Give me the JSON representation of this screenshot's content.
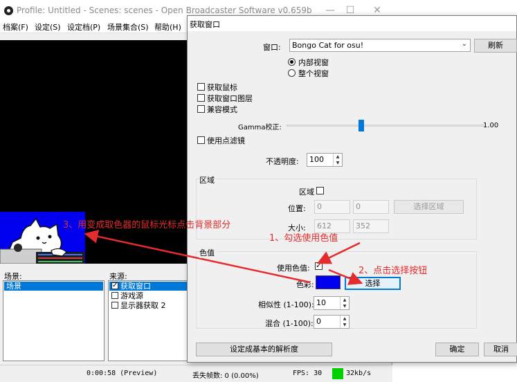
{
  "obs": {
    "title": "Profile: Untitled - Scenes: scenes - Open Broadcaster Software v0.659b",
    "menu": [
      "档案(F)",
      "设定(S)",
      "设定档(P)",
      "场景集合(S)",
      "帮助(H)"
    ],
    "scenes_label": "场景:",
    "scenes": [
      "场景"
    ],
    "sources_label": "来源:",
    "sources": [
      {
        "label": "获取窗口",
        "checked": true,
        "selected": true
      },
      {
        "label": "游戏源",
        "checked": false,
        "selected": false
      },
      {
        "label": "显示器获取 2",
        "checked": false,
        "selected": false
      }
    ],
    "status": {
      "time": "0:00:58 (Preview)",
      "dropped": "丢失帧数: 0 (0.00%)",
      "fps": "FPS: 30",
      "bitrate": "32kb/s"
    }
  },
  "dialog": {
    "title": "获取窗口",
    "window_label": "窗口:",
    "window_value": "Bongo Cat for osu!",
    "refresh": "刷新",
    "radio_inner": "内部视窗",
    "radio_whole": "整个视窗",
    "cb_cursor": "获取鼠标",
    "cb_layers": "获取窗口图层",
    "cb_compat": "兼容模式",
    "gamma_label": "Gamma校正:",
    "gamma_value": "1.00",
    "cb_pointfilter": "使用点滤镜",
    "opacity_label": "不透明度:",
    "opacity_value": "100",
    "region_group": "区域",
    "region_label": "区域",
    "position_label": "位置:",
    "position_x": "0",
    "position_y": "0",
    "select_region": "选择区域",
    "size_label": "大小:",
    "size_w": "612",
    "size_h": "352",
    "color_group": "色值",
    "use_color_label": "使用色值:",
    "color_label": "色彩:",
    "select_button": "选择",
    "similarity_label": "相似性 (1-100):",
    "similarity_value": "10",
    "blend_label": "混合 (1-100):",
    "blend_value": "0",
    "base_res_button": "设定成基本的解析度",
    "ok": "确定",
    "cancel": "取消"
  },
  "annotations": {
    "step1": "1、勾选使用色值",
    "step2": "2、点击选择按钮",
    "step3": "3、用变成取色器的鼠标光标点击背景部分"
  },
  "colors": {
    "annotation": "#e52b2b",
    "key_color": "#0000ee",
    "accent": "#0078d7"
  }
}
